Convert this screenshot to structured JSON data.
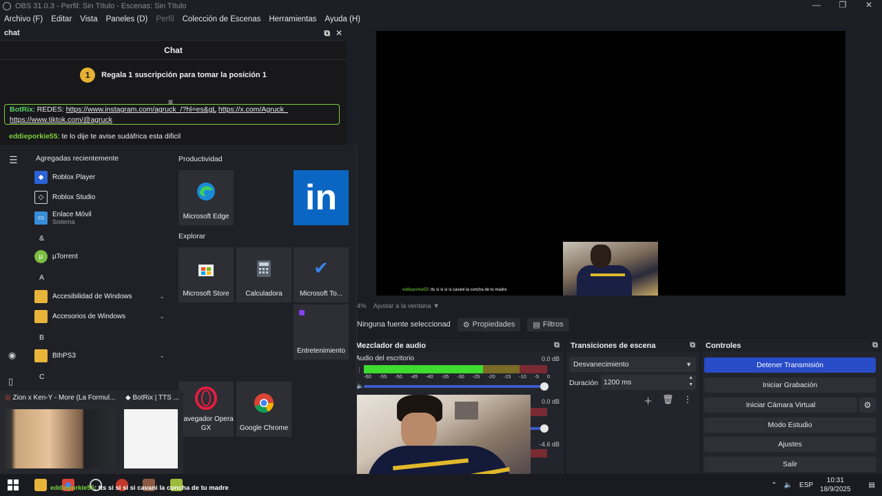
{
  "window": {
    "title": "OBS 31.0.3 - Perfil: Sin Título - Escenas: Sin Título"
  },
  "menu": [
    "Archivo (F)",
    "Editar",
    "Vista",
    "Paneles (D)",
    "Perfil",
    "Colección de Escenas",
    "Herramientas",
    "Ayuda (H)"
  ],
  "chat_dock": {
    "header": "chat",
    "panel_title": "Chat",
    "rank": "1",
    "gift_text": "Regala 1 suscripción para tomar la posición 1",
    "pinned_user": "BotRix",
    "pinned_text": ": REDES: ",
    "pinned_link1": "https://www.instagram.com/agruck_/?hl=es&gL",
    "pinned_link2": "https://x.com/Agruck_",
    "pinned_link3": "https://www.tiktok.com/@agruck",
    "msg_user": "eddieporkie55",
    "msg_text": ": te lo dije te avise sudáfrica esta dificil"
  },
  "start_menu": {
    "recent_heading": "Agregadas recientemente",
    "productivity_heading": "Productividad",
    "explore_heading": "Explorar",
    "apps": [
      {
        "name": "Roblox Player"
      },
      {
        "name": "Roblox Studio"
      },
      {
        "name": "Enlace Móvil",
        "sub": "Sistema"
      },
      {
        "name": "µTorrent"
      },
      {
        "name": "Accesibilidad de Windows"
      },
      {
        "name": "Accesorios de Windows"
      },
      {
        "name": "BthPS3"
      }
    ],
    "letters": [
      "&",
      "A",
      "B",
      "C"
    ],
    "tiles": {
      "edge": "Microsoft Edge",
      "store": "Microsoft Store",
      "calc": "Calculadora",
      "todo": "Microsoft To...",
      "ent": "Entretenimiento",
      "opera": "Navegador Opera GX",
      "chrome": "Google Chrome"
    }
  },
  "taskbar_previews": [
    {
      "title": "Zion x Ken-Y - More (La Formul..."
    },
    {
      "title": "BotRix | TTS ..."
    }
  ],
  "preview": {
    "caption_user": "eddieporkie55",
    "caption_text": ": tts si si si si cavani la concha de tu madre",
    "zoom": "4%",
    "fit_label": "Ajustar a la ventana"
  },
  "source_toolbar": {
    "no_source": "Ninguna fuente seleccionad",
    "properties": "Propiedades",
    "filters": "Filtros"
  },
  "audio_mixer": {
    "title": "Mezclador de audio",
    "channels": [
      {
        "name": "Audio del escritorio",
        "db": "0.0 dB",
        "level": 0.65
      },
      {
        "name": "",
        "db": "0.0 dB",
        "level": 0.0
      },
      {
        "name": "",
        "db": "-4.6 dB",
        "level": 0.0
      }
    ],
    "ticks": [
      "-60",
      "-55",
      "-50",
      "-45",
      "-40",
      "-35",
      "-30",
      "-25",
      "-20",
      "-15",
      "-10",
      "-5",
      "0"
    ]
  },
  "transitions": {
    "title": "Transiciones de escena",
    "selected": "Desvanecimiento",
    "duration_label": "Duración",
    "duration_value": "1200 ms"
  },
  "controls": {
    "title": "Controles",
    "stop_stream": "Detener Transmisión",
    "start_record": "Iniciar Grabación",
    "virtual_cam": "Iniciar Cámara Virtual",
    "studio_mode": "Modo Estudio",
    "settings": "Ajustes",
    "exit": "Salir"
  },
  "taskbar": {
    "caption_user": "eddieporkie55",
    "caption_text": ": tts si si si si cavani la concha de tu madre",
    "lang": "ESP",
    "time": "10:31",
    "date": "18/9/2025"
  },
  "colors": {
    "accent": "#284cc8",
    "chat_green": "#7dd23c",
    "meter_green": "#3ddc2f"
  }
}
